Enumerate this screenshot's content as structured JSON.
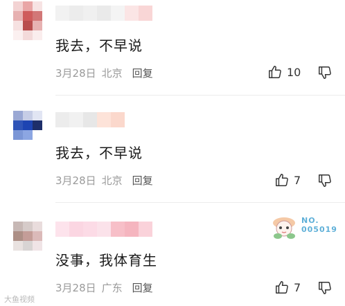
{
  "comments": [
    {
      "text": "我去，不早说",
      "date": "3月28日",
      "location": "北京",
      "reply": "回复",
      "likes": "10"
    },
    {
      "text": "我去，不早说",
      "date": "3月28日",
      "location": "北京",
      "reply": "回复",
      "likes": "7"
    },
    {
      "text": "没事，我体育生",
      "date": "3月28日",
      "location": "广东",
      "reply": "回复",
      "likes": "7",
      "badge": "NO.\n005019"
    }
  ],
  "icons": {
    "like": "thumb-up-icon",
    "dislike": "thumb-down-icon"
  },
  "watermark": "大鱼视频"
}
